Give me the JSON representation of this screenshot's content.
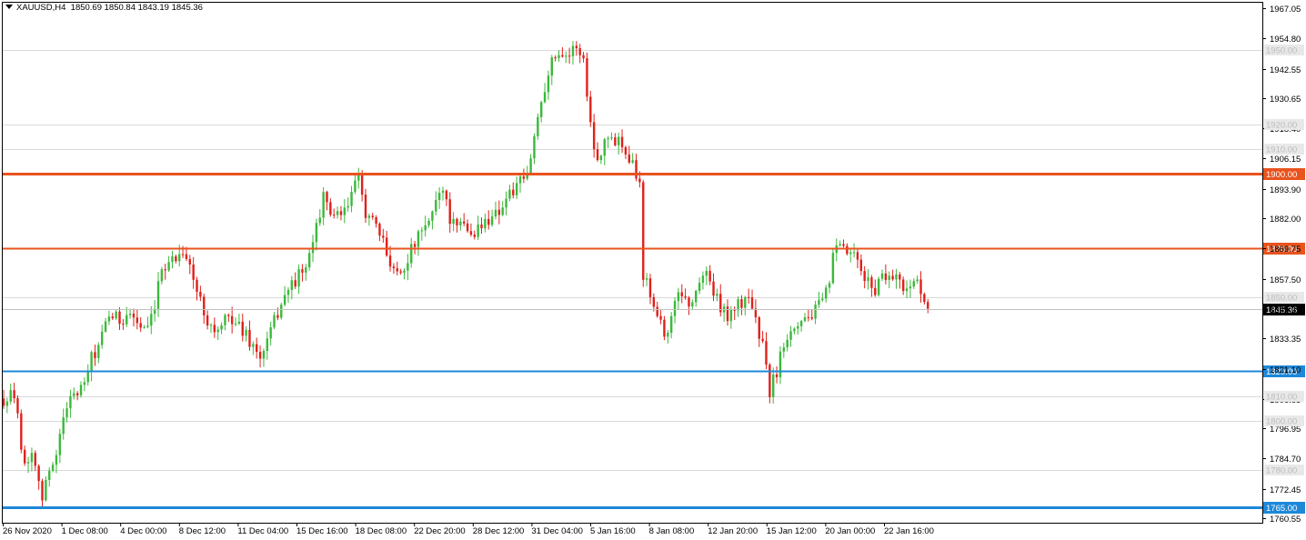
{
  "header": {
    "symbol": "XAUUSD,H4",
    "open": "1850.69",
    "high": "1850.84",
    "low": "1843.19",
    "close": "1845.36"
  },
  "chart_data": {
    "type": "candlestick",
    "ylim": [
      1760.55,
      1967.05
    ],
    "y_ticks": [
      1967.05,
      1954.8,
      1942.55,
      1930.65,
      1918.4,
      1906.15,
      1893.9,
      1882.0,
      1869.75,
      1857.5,
      1845.25,
      1833.35,
      1821.1,
      1808.85,
      1796.95,
      1784.7,
      1772.45,
      1760.55
    ],
    "x_ticks": [
      "26 Nov 2020",
      "1 Dec 08:00",
      "4 Dec 00:00",
      "8 Dec 12:00",
      "11 Dec 04:00",
      "15 Dec 16:00",
      "18 Dec 08:00",
      "22 Dec 20:00",
      "28 Dec 12:00",
      "31 Dec 04:00",
      "5 Jan 16:00",
      "8 Jan 08:00",
      "12 Jan 20:00",
      "15 Jan 12:00",
      "20 Jan 00:00",
      "22 Jan 16:00"
    ],
    "levels": [
      {
        "value": 1900.0,
        "label": "1900.00",
        "color": "#e8531e",
        "width": 3
      },
      {
        "value": 1870.0,
        "label": "1870.00",
        "color": "#e8531e",
        "width": 2
      },
      {
        "value": 1820.0,
        "label": "1820.00",
        "color": "#1e88d8",
        "width": 2
      },
      {
        "value": 1765.0,
        "label": "1765.00",
        "color": "#1e88d8",
        "width": 3
      }
    ],
    "grid_levels": [
      1950.0,
      1920.0,
      1910.0,
      1850.0,
      1810.0,
      1800.0,
      1780.0
    ],
    "last_price": {
      "value": 1845.36,
      "label": "1845.36"
    },
    "anchors": [
      [
        0,
        1809
      ],
      [
        2,
        1810
      ],
      [
        4,
        1806
      ],
      [
        5,
        1790
      ],
      [
        6,
        1782
      ],
      [
        8,
        1788
      ],
      [
        10,
        1778
      ],
      [
        11,
        1768
      ],
      [
        13,
        1780
      ],
      [
        15,
        1788
      ],
      [
        17,
        1800
      ],
      [
        19,
        1812
      ],
      [
        21,
        1810
      ],
      [
        23,
        1815
      ],
      [
        25,
        1825
      ],
      [
        27,
        1830
      ],
      [
        29,
        1838
      ],
      [
        31,
        1843
      ],
      [
        33,
        1840
      ],
      [
        35,
        1844
      ],
      [
        37,
        1842
      ],
      [
        39,
        1838
      ],
      [
        41,
        1836
      ],
      [
        43,
        1845
      ],
      [
        45,
        1862
      ],
      [
        47,
        1865
      ],
      [
        49,
        1866
      ],
      [
        51,
        1870
      ],
      [
        53,
        1862
      ],
      [
        55,
        1852
      ],
      [
        57,
        1845
      ],
      [
        59,
        1838
      ],
      [
        61,
        1836
      ],
      [
        63,
        1840
      ],
      [
        65,
        1842
      ],
      [
        67,
        1838
      ],
      [
        69,
        1835
      ],
      [
        71,
        1830
      ],
      [
        73,
        1825
      ],
      [
        75,
        1832
      ],
      [
        77,
        1840
      ],
      [
        79,
        1848
      ],
      [
        81,
        1853
      ],
      [
        83,
        1857
      ],
      [
        85,
        1860
      ],
      [
        87,
        1865
      ],
      [
        89,
        1880
      ],
      [
        91,
        1890
      ],
      [
        93,
        1885
      ],
      [
        95,
        1882
      ],
      [
        97,
        1884
      ],
      [
        99,
        1892
      ],
      [
        101,
        1898
      ],
      [
        103,
        1885
      ],
      [
        105,
        1880
      ],
      [
        107,
        1875
      ],
      [
        109,
        1868
      ],
      [
        111,
        1862
      ],
      [
        113,
        1860
      ],
      [
        115,
        1866
      ],
      [
        117,
        1872
      ],
      [
        119,
        1876
      ],
      [
        121,
        1880
      ],
      [
        123,
        1890
      ],
      [
        125,
        1895
      ],
      [
        127,
        1882
      ],
      [
        129,
        1877
      ],
      [
        131,
        1880
      ],
      [
        133,
        1875
      ],
      [
        135,
        1878
      ],
      [
        137,
        1880
      ],
      [
        139,
        1884
      ],
      [
        141,
        1885
      ],
      [
        143,
        1890
      ],
      [
        145,
        1893
      ],
      [
        147,
        1896
      ],
      [
        149,
        1899
      ],
      [
        151,
        1915
      ],
      [
        153,
        1930
      ],
      [
        155,
        1942
      ],
      [
        157,
        1948
      ],
      [
        159,
        1950
      ],
      [
        161,
        1948
      ],
      [
        163,
        1952
      ],
      [
        165,
        1946
      ],
      [
        167,
        1920
      ],
      [
        169,
        1905
      ],
      [
        171,
        1915
      ],
      [
        173,
        1913
      ],
      [
        175,
        1915
      ],
      [
        177,
        1910
      ],
      [
        179,
        1905
      ],
      [
        181,
        1895
      ],
      [
        182,
        1860
      ],
      [
        184,
        1852
      ],
      [
        186,
        1845
      ],
      [
        188,
        1835
      ],
      [
        190,
        1840
      ],
      [
        192,
        1853
      ],
      [
        194,
        1850
      ],
      [
        196,
        1846
      ],
      [
        198,
        1858
      ],
      [
        200,
        1860
      ],
      [
        202,
        1852
      ],
      [
        204,
        1845
      ],
      [
        206,
        1843
      ],
      [
        208,
        1846
      ],
      [
        210,
        1847
      ],
      [
        212,
        1852
      ],
      [
        214,
        1840
      ],
      [
        216,
        1830
      ],
      [
        218,
        1812
      ],
      [
        220,
        1820
      ],
      [
        222,
        1832
      ],
      [
        224,
        1838
      ],
      [
        226,
        1840
      ],
      [
        228,
        1842
      ],
      [
        230,
        1843
      ],
      [
        232,
        1846
      ],
      [
        234,
        1851
      ],
      [
        236,
        1866
      ],
      [
        238,
        1870
      ],
      [
        240,
        1868
      ],
      [
        242,
        1866
      ],
      [
        244,
        1860
      ],
      [
        246,
        1856
      ],
      [
        248,
        1853
      ],
      [
        250,
        1860
      ],
      [
        252,
        1858
      ],
      [
        254,
        1860
      ],
      [
        256,
        1852
      ],
      [
        258,
        1857
      ],
      [
        260,
        1855
      ],
      [
        261,
        1851
      ],
      [
        262,
        1848
      ],
      [
        263,
        1845.36
      ]
    ],
    "bar_step": 3.864,
    "first_bar_x": 4,
    "price_axis_x": 1388
  }
}
